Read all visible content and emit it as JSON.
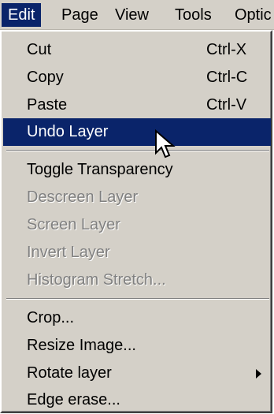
{
  "menubar": {
    "items": [
      {
        "label": "Edit"
      },
      {
        "label": "Page"
      },
      {
        "label": "View"
      },
      {
        "label": "Tools"
      },
      {
        "label": "Optic"
      }
    ]
  },
  "edit_menu": {
    "items": [
      {
        "label": "Cut",
        "shortcut": "Ctrl-X"
      },
      {
        "label": "Copy",
        "shortcut": "Ctrl-C"
      },
      {
        "label": "Paste",
        "shortcut": "Ctrl-V"
      },
      {
        "label": "Undo Layer",
        "highlighted": true
      },
      {
        "label": "Toggle Transparency"
      },
      {
        "label": "Descreen Layer",
        "enabled": false
      },
      {
        "label": "Screen Layer",
        "enabled": false
      },
      {
        "label": "Invert Layer",
        "enabled": false
      },
      {
        "label": "Histogram Stretch...",
        "enabled": false
      },
      {
        "label": "Crop..."
      },
      {
        "label": "Resize Image..."
      },
      {
        "label": "Rotate layer",
        "has_submenu": true
      },
      {
        "label": "Edge erase..."
      }
    ]
  },
  "colors": {
    "menu_background": "#d4d0c8",
    "highlight": "#0a246a",
    "highlight_text": "#ffffff",
    "disabled_text": "#808080"
  },
  "icons": {
    "cursor": "arrow-cursor-icon",
    "submenu": "submenu-arrow-icon"
  }
}
